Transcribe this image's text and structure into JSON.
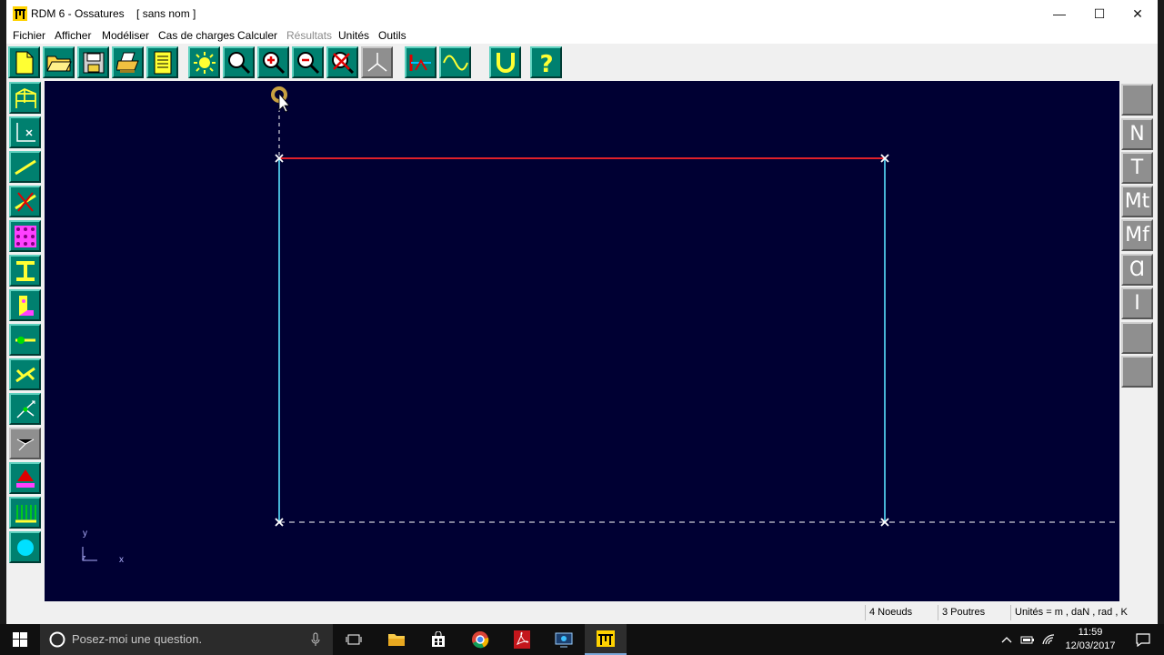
{
  "window": {
    "title": "RDM 6 - Ossatures    [ sans nom ]",
    "minimize_glyph": "—",
    "maximize_glyph": "☐",
    "close_glyph": "✕"
  },
  "menu": {
    "items": [
      {
        "label": "Fichier",
        "enabled": true
      },
      {
        "label": "Afficher",
        "enabled": true
      },
      {
        "label": "Modéliser",
        "enabled": true
      },
      {
        "label": "Cas de charges",
        "enabled": true
      },
      {
        "label": "Calculer",
        "enabled": true
      },
      {
        "label": "Résultats",
        "enabled": false
      },
      {
        "label": "Unités",
        "enabled": true
      },
      {
        "label": "Outils",
        "enabled": true
      }
    ]
  },
  "toolbar": {
    "icons": [
      "new-file-icon",
      "open-folder-icon",
      "save-disk-icon",
      "print-icon",
      "notepad-icon",
      "sun-icon",
      "zoom-icon",
      "zoom-in-icon",
      "zoom-out-icon",
      "zoom-cancel-icon",
      "axes-3d-icon",
      "section-icon",
      "wave-icon",
      "magnet-icon",
      "help-icon"
    ]
  },
  "left_toolbar": {
    "icons": [
      "frame-icon",
      "node-coordinates-icon",
      "beam-icon",
      "delete-beam-icon",
      "mesh-icon",
      "i-section-icon",
      "material-icon",
      "release-icon",
      "rigid-link-icon",
      "support-icon",
      "disabled-support-icon",
      "load-icon",
      "distributed-load-icon",
      "circle-icon"
    ]
  },
  "right_toolbar": {
    "labels": [
      "",
      "N",
      "T",
      "Mt",
      "Mf",
      "Ɑ",
      "I",
      "",
      ""
    ]
  },
  "canvas": {
    "axis_y_label": "y",
    "axis_x_label": "x",
    "axis_z_label": "z",
    "colors": {
      "background": "#000033",
      "beam_top": "#e0202a",
      "columns": "#4fc8e8",
      "ground_line": "#ffffff",
      "node_marker": "#ffffff"
    }
  },
  "status": {
    "nodes": "4 Noeuds",
    "beams": "3 Poutres",
    "units": "Unités = m , daN , rad , K"
  },
  "taskbar": {
    "search_placeholder": "Posez-moi une question.",
    "time": "11:59",
    "date": "12/03/2017"
  }
}
